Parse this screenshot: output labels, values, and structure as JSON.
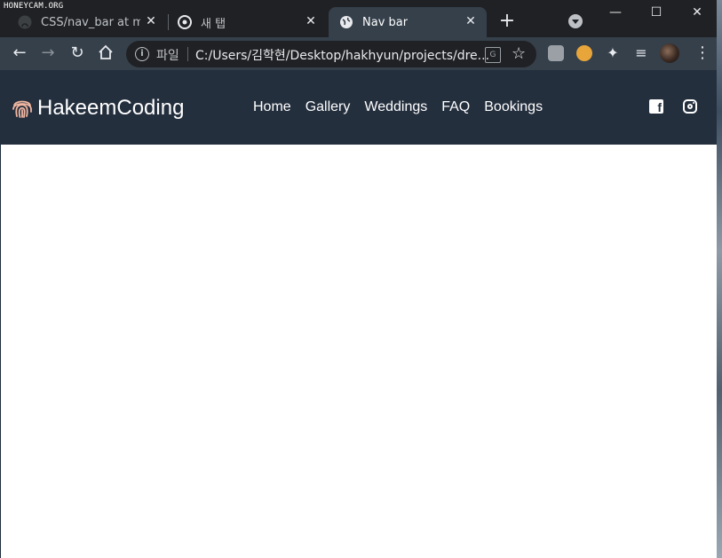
{
  "watermark": "HONEYCAM.ORG",
  "tabs": [
    {
      "title": "CSS/nav_bar at main",
      "icon": "github-icon"
    },
    {
      "title": "새 탭",
      "icon": "chrome-icon"
    },
    {
      "title": "Nav bar",
      "icon": "globe-icon"
    }
  ],
  "toolbar": {
    "file_label": "파일",
    "url": "C:/Users/김학현/Desktop/hakhyun/projects/dre..."
  },
  "site": {
    "brand": "HakeemCoding",
    "menu": [
      "Home",
      "Gallery",
      "Weddings",
      "FAQ",
      "Bookings"
    ],
    "social": [
      "facebook-icon",
      "instagram-icon"
    ]
  },
  "colors": {
    "navbar_bg": "#242f3e",
    "accent": "#f2b8a2",
    "tabstrip_bg": "#202124",
    "toolbar_bg": "#35404b"
  }
}
